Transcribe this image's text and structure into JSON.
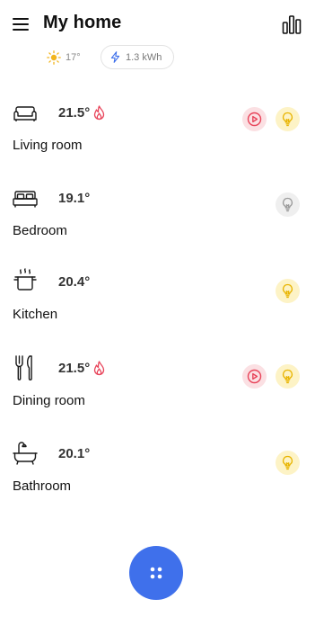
{
  "header": {
    "title": "My home",
    "menu_icon": "menu-icon",
    "stats_icon": "bar-chart-icon"
  },
  "status": {
    "weather_temp": "17°",
    "weather_icon": "sun-icon",
    "energy": "1.3 kWh",
    "energy_icon": "lightning-icon"
  },
  "rooms": [
    {
      "name": "Living room",
      "temp": "21.5°",
      "icon": "sofa-icon",
      "heating": true,
      "media": true,
      "light": "on"
    },
    {
      "name": "Bedroom",
      "temp": "19.1°",
      "icon": "bed-icon",
      "heating": false,
      "media": false,
      "light": "off"
    },
    {
      "name": "Kitchen",
      "temp": "20.4°",
      "icon": "cooking-pot-icon",
      "heating": false,
      "media": false,
      "light": "on"
    },
    {
      "name": "Dining room",
      "temp": "21.5°",
      "icon": "fork-knife-icon",
      "heating": true,
      "media": true,
      "light": "on"
    },
    {
      "name": "Bathroom",
      "temp": "20.1°",
      "icon": "bathtub-icon",
      "heating": false,
      "media": false,
      "light": "on"
    }
  ],
  "fab": {
    "icon": "four-dots-icon"
  },
  "colors": {
    "accent": "#3f70eb",
    "flame": "#e8445a",
    "media_bg": "#fbe0e3",
    "media_fg": "#e8445a",
    "light_on_bg": "#fdf3c6",
    "light_on_fg": "#e8b400",
    "light_off_bg": "#efefef",
    "light_off_fg": "#9a9a9a",
    "energy": "#3f70eb",
    "sun": "#f2b51d"
  }
}
